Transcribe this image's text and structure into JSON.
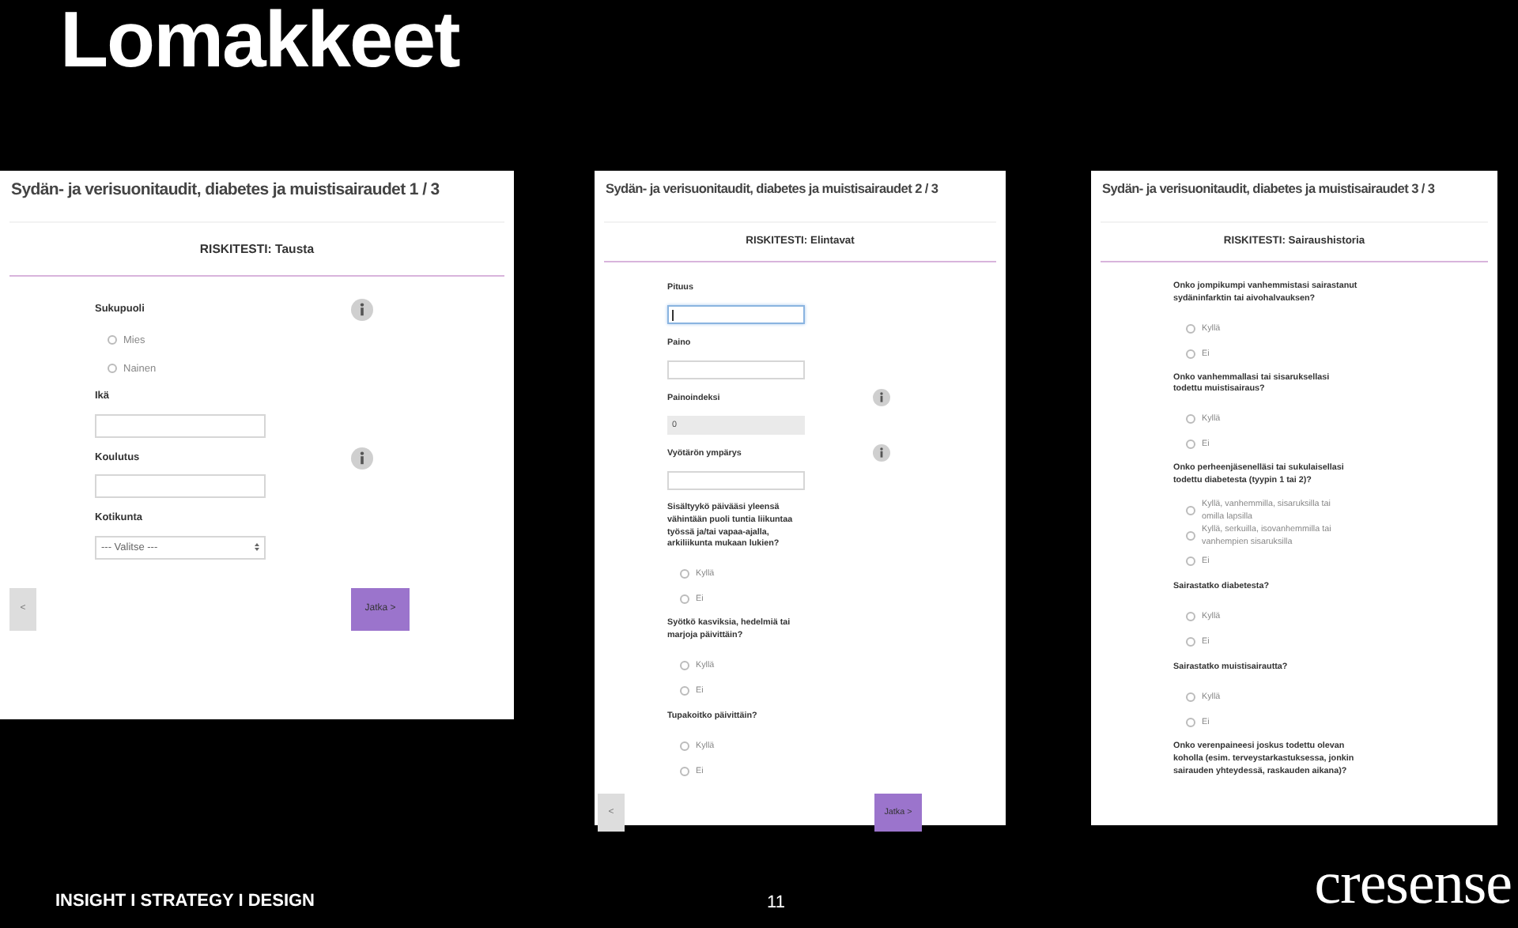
{
  "slide": {
    "title": "Lomakkeet"
  },
  "forms": [
    {
      "title": "Sydän- ja verisuonitaudit, diabetes ja muistisairaudet 1 / 3",
      "heading": "RISKITESTI: Tausta",
      "back_button": "<",
      "next_button": "Jatka >",
      "items": [
        {
          "kind": "label",
          "text": "Sukupuoli",
          "info": true
        },
        {
          "kind": "radio",
          "text": "Mies",
          "selected": false
        },
        {
          "kind": "radio",
          "text": "Nainen",
          "selected": false
        },
        {
          "kind": "label",
          "text": "Ikä",
          "info": false
        },
        {
          "kind": "field",
          "focused": false,
          "disabled": false
        },
        {
          "kind": "label",
          "text": "Koulutus",
          "info": true
        },
        {
          "kind": "field",
          "focused": false,
          "disabled": false
        },
        {
          "kind": "label",
          "text": "Kotikunta",
          "info": false
        },
        {
          "kind": "select",
          "value": "--- Valitse ---"
        }
      ]
    },
    {
      "title": "Sydän- ja verisuonitaudit, diabetes ja muistisairaudet 2 / 3",
      "heading": "RISKITESTI: Elintavat",
      "back_button": "<",
      "next_button": "Jatka >",
      "items": [
        {
          "kind": "label",
          "text": "Pituus",
          "info": false
        },
        {
          "kind": "field",
          "focused": true,
          "disabled": false
        },
        {
          "kind": "label",
          "text": "Paino",
          "info": false
        },
        {
          "kind": "field",
          "focused": false,
          "disabled": false
        },
        {
          "kind": "label",
          "text": "Painoindeksi",
          "info": true
        },
        {
          "kind": "field",
          "value": "0",
          "focused": false,
          "disabled": true
        },
        {
          "kind": "label",
          "text": "Vyötärön ympärys",
          "info": true
        },
        {
          "kind": "field",
          "focused": false,
          "disabled": false
        },
        {
          "kind": "label",
          "text": "Sisältyykö päivääsi yleensä vähintään puoli tuntia liikuntaa työssä ja/tai vapaa-ajalla, arkiliikunta mukaan lukien?",
          "info": false
        },
        {
          "kind": "radio",
          "text": "Kyllä",
          "selected": false
        },
        {
          "kind": "radio",
          "text": "Ei",
          "selected": false
        },
        {
          "kind": "label",
          "text": "Syötkö kasviksia, hedelmiä tai marjoja päivittäin?",
          "info": false
        },
        {
          "kind": "radio",
          "text": "Kyllä",
          "selected": false
        },
        {
          "kind": "radio",
          "text": "Ei",
          "selected": false
        },
        {
          "kind": "label",
          "text": "Tupakoitko päivittäin?",
          "info": false
        },
        {
          "kind": "radio",
          "text": "Kyllä",
          "selected": false
        },
        {
          "kind": "radio",
          "text": "Ei",
          "selected": false
        }
      ]
    },
    {
      "title": "Sydän- ja verisuonitaudit, diabetes ja muistisairaudet 3 / 3",
      "heading": "RISKITESTI: Sairaushistoria",
      "items": [
        {
          "kind": "label",
          "text": "Onko jompikumpi vanhemmistasi sairastanut sydäninfarktin tai aivohalvauksen?",
          "info": false
        },
        {
          "kind": "radio",
          "text": "Kyllä",
          "selected": false
        },
        {
          "kind": "radio",
          "text": "Ei",
          "selected": false
        },
        {
          "kind": "label",
          "text": "Onko vanhemmallasi tai sisaruksellasi todettu muistisairaus?",
          "info": false
        },
        {
          "kind": "radio",
          "text": "Kyllä",
          "selected": false
        },
        {
          "kind": "radio",
          "text": "Ei",
          "selected": false
        },
        {
          "kind": "label",
          "text": "Onko perheenjäsenelläsi tai sukulaisellasi todettu diabetesta (tyypin 1 tai 2)?",
          "info": false
        },
        {
          "kind": "radio",
          "text": "Kyllä, vanhemmilla, sisaruksilla tai omilla lapsilla",
          "selected": false
        },
        {
          "kind": "radio",
          "text": "Kyllä, serkuilla, isovanhemmilla tai vanhempien sisaruksilla",
          "selected": false
        },
        {
          "kind": "radio",
          "text": "Ei",
          "selected": false
        },
        {
          "kind": "label",
          "text": "Sairastatko diabetesta?",
          "info": false
        },
        {
          "kind": "radio",
          "text": "Kyllä",
          "selected": false
        },
        {
          "kind": "radio",
          "text": "Ei",
          "selected": false
        },
        {
          "kind": "label",
          "text": "Sairastatko muistisairautta?",
          "info": false
        },
        {
          "kind": "radio",
          "text": "Kyllä",
          "selected": false
        },
        {
          "kind": "radio",
          "text": "Ei",
          "selected": false
        },
        {
          "kind": "label",
          "text": "Onko verenpaineesi joskus todettu olevan koholla (esim. terveystarkastuksessa, jonkin sairauden yhteydessä, raskauden aikana)?",
          "info": false
        }
      ]
    }
  ],
  "footer": {
    "tagline": "INSIGHT I STRATEGY I DESIGN",
    "page_number": "11",
    "logo": "cresense"
  }
}
